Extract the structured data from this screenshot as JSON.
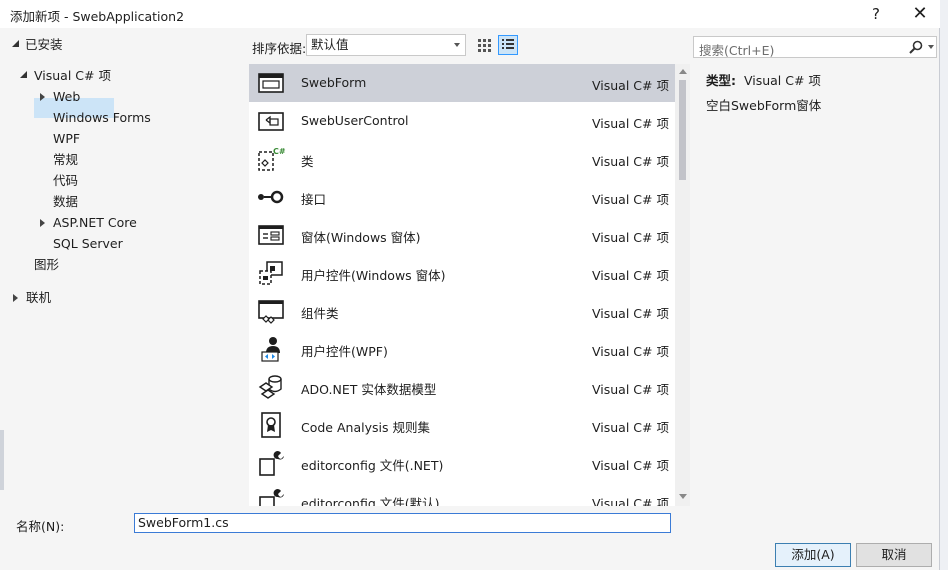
{
  "window": {
    "title": "添加新项 - SwebApplication2",
    "help": "?",
    "close": "✕"
  },
  "tree": {
    "installed": "已安装",
    "visual_cs": "Visual C# 项",
    "children": [
      "Web",
      "Windows Forms",
      "WPF",
      "常规",
      "代码",
      "数据",
      "ASP.NET Core",
      "SQL Server"
    ],
    "graphics": "图形",
    "online": "联机"
  },
  "toolbar": {
    "sort_label": "排序依据:",
    "sort_value": "默认值",
    "search_placeholder": "搜索(Ctrl+E)"
  },
  "templates": [
    {
      "name": "SwebForm",
      "lang": "Visual C# 项",
      "icon": "form-icon",
      "selected": true
    },
    {
      "name": "SwebUserControl",
      "lang": "Visual C# 项",
      "icon": "user-control-icon"
    },
    {
      "name": "类",
      "lang": "Visual C# 项",
      "icon": "class-icon"
    },
    {
      "name": "接口",
      "lang": "Visual C# 项",
      "icon": "interface-icon"
    },
    {
      "name": "窗体(Windows 窗体)",
      "lang": "Visual C# 项",
      "icon": "windows-form-icon"
    },
    {
      "name": "用户控件(Windows 窗体)",
      "lang": "Visual C# 项",
      "icon": "windows-user-control-icon"
    },
    {
      "name": "组件类",
      "lang": "Visual C# 项",
      "icon": "component-class-icon"
    },
    {
      "name": "用户控件(WPF)",
      "lang": "Visual C# 项",
      "icon": "wpf-user-control-icon"
    },
    {
      "name": "ADO.NET 实体数据模型",
      "lang": "Visual C# 项",
      "icon": "entity-model-icon"
    },
    {
      "name": "Code Analysis 规则集",
      "lang": "Visual C# 项",
      "icon": "ruleset-icon"
    },
    {
      "name": "editorconfig 文件(.NET)",
      "lang": "Visual C# 项",
      "icon": "editorconfig-icon"
    },
    {
      "name": "editorconfig 文件(默认)",
      "lang": "Visual C# 项",
      "icon": "editorconfig-default-icon"
    }
  ],
  "details": {
    "type_label": "类型:",
    "type_value": "Visual C# 项",
    "description": "空白SwebForm窗体"
  },
  "footer": {
    "name_label": "名称(N):",
    "name_value": "SwebForm1.cs",
    "add_button": "添加(A)",
    "cancel_button": "取消"
  }
}
